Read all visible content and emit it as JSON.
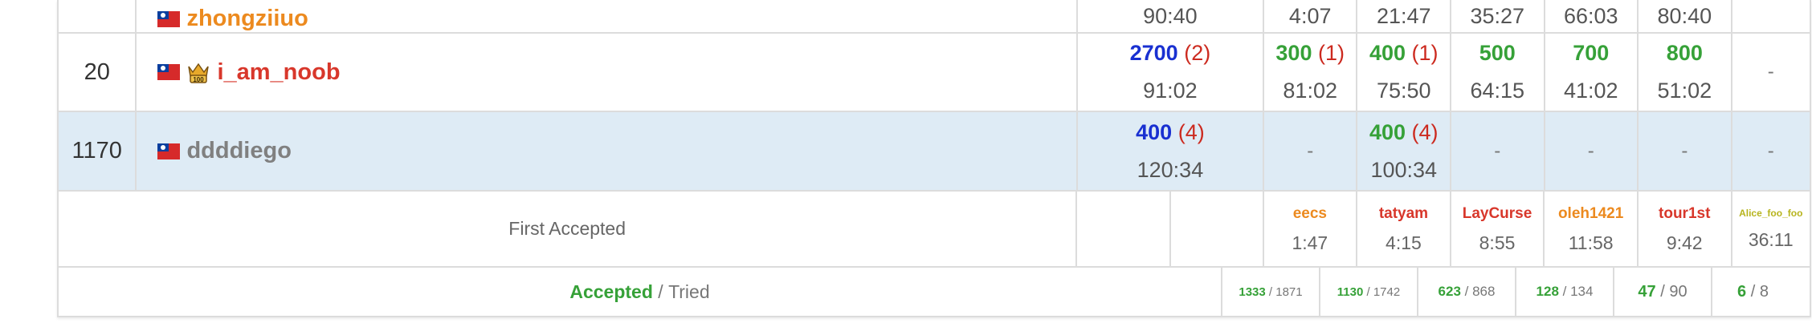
{
  "rows": [
    {
      "rank": "",
      "user": "zhongziiuo",
      "user_color": "#ec8a1f",
      "highlight": false,
      "cells": [
        {
          "time": "90:40"
        },
        {
          "time": "4:07"
        },
        {
          "time": "21:47"
        },
        {
          "time": "35:27"
        },
        {
          "time": "66:03"
        },
        {
          "time": "80:40"
        },
        {
          "time": ""
        }
      ]
    },
    {
      "rank": "20",
      "user": "i_am_noob",
      "user_color": "#d8372b",
      "crown": "100-crown-icon",
      "highlight": false,
      "cells": [
        {
          "score": "2700",
          "tries": "(2)",
          "time": "91:02",
          "color": "#1930d1"
        },
        {
          "score": "300",
          "tries": "(1)",
          "time": "81:02",
          "color": "#36a138"
        },
        {
          "score": "400",
          "tries": "(1)",
          "time": "75:50",
          "color": "#36a138"
        },
        {
          "score": "500",
          "time": "64:15",
          "color": "#36a138"
        },
        {
          "score": "700",
          "time": "41:02",
          "color": "#36a138"
        },
        {
          "score": "800",
          "time": "51:02",
          "color": "#36a138"
        },
        {
          "dash": "-"
        }
      ]
    },
    {
      "rank": "1170",
      "user": "ddddiego",
      "user_color": "#808080",
      "highlight": true,
      "cells": [
        {
          "score": "400",
          "tries": "(4)",
          "time": "120:34",
          "color": "#1930d1"
        },
        {
          "dash": "-"
        },
        {
          "score": "400",
          "tries": "(4)",
          "time": "100:34",
          "color": "#36a138"
        },
        {
          "dash": "-"
        },
        {
          "dash": "-"
        },
        {
          "dash": "-"
        },
        {
          "dash": "-"
        }
      ]
    }
  ],
  "first_accepted": {
    "label": "First Accepted",
    "entries": [
      {
        "name": "eecs",
        "time": "1:47",
        "color": "#ec8a1f"
      },
      {
        "name": "tatyam",
        "time": "4:15",
        "color": "#d8372b"
      },
      {
        "name": "LayCurse",
        "time": "8:55",
        "color": "#d8372b"
      },
      {
        "name": "oleh1421",
        "time": "11:58",
        "color": "#ec8a1f"
      },
      {
        "name": "tour1st",
        "time": "9:42",
        "color": "#d8372b"
      },
      {
        "name": "Alice_foo_foo",
        "time": "36:11",
        "color": "#b7b41d"
      }
    ]
  },
  "accepted_tried": {
    "accepted_label": "Accepted",
    "separator": " / ",
    "tried_label": "Tried",
    "entries": [
      {
        "accepted": "1333",
        "tried": "1871"
      },
      {
        "accepted": "1130",
        "tried": "1742"
      },
      {
        "accepted": "623",
        "tried": "868"
      },
      {
        "accepted": "128",
        "tried": "134"
      },
      {
        "accepted": "47",
        "tried": "90"
      },
      {
        "accepted": "6",
        "tried": "8"
      }
    ]
  }
}
